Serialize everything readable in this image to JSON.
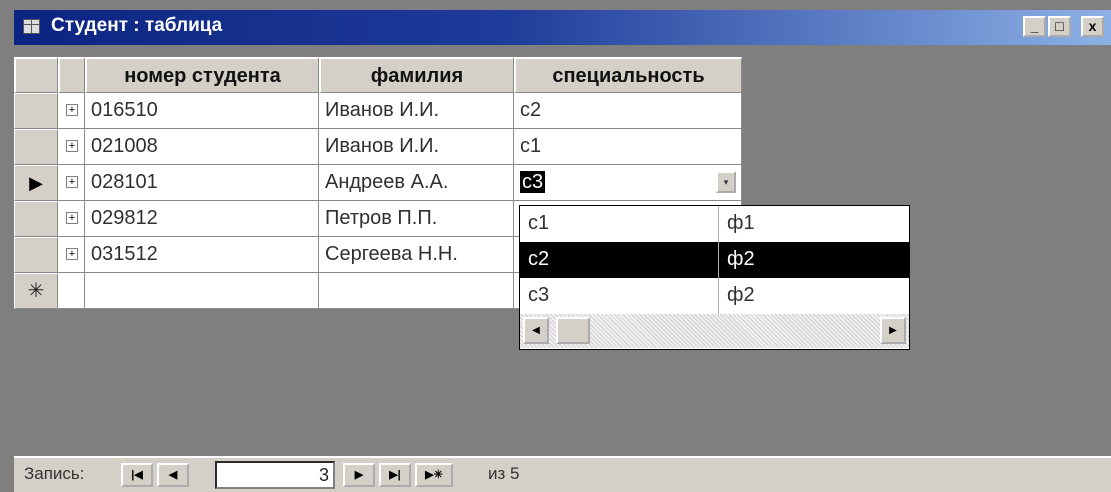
{
  "window": {
    "title": "Студент : таблица",
    "controls": {
      "minimize": "_",
      "maximize": "□",
      "close": "x"
    }
  },
  "table": {
    "columns": [
      "номер студента",
      "фамилия",
      "специальность"
    ],
    "rows": [
      {
        "expand": "+",
        "number": "016510",
        "surname": "Иванов И.И.",
        "specialty": "c2"
      },
      {
        "expand": "+",
        "number": "021008",
        "surname": "Иванов И.И.",
        "specialty": "c1"
      },
      {
        "expand": "+",
        "number": "028101",
        "surname": "Андреев А.А.",
        "specialty": "c3"
      },
      {
        "expand": "+",
        "number": "029812",
        "surname": "Петров П.П.",
        "specialty": ""
      },
      {
        "expand": "+",
        "number": "031512",
        "surname": "Сергеева Н.Н.",
        "specialty": ""
      }
    ],
    "current_row_marker": "▶",
    "new_row_marker": "✳"
  },
  "dropdown": {
    "items": [
      {
        "code": "c1",
        "name": "ф1",
        "selected": false
      },
      {
        "code": "c2",
        "name": "ф2",
        "selected": true
      },
      {
        "code": "c3",
        "name": "ф2",
        "selected": false
      }
    ],
    "button_icon": "▾",
    "scroll_left": "◀",
    "scroll_right": "▶"
  },
  "statusbar": {
    "label": "Запись:",
    "first": "|◀",
    "prev": "◀",
    "current": "3",
    "next": "▶",
    "last": "▶|",
    "new": "▶✳",
    "of_text": "из 5"
  }
}
